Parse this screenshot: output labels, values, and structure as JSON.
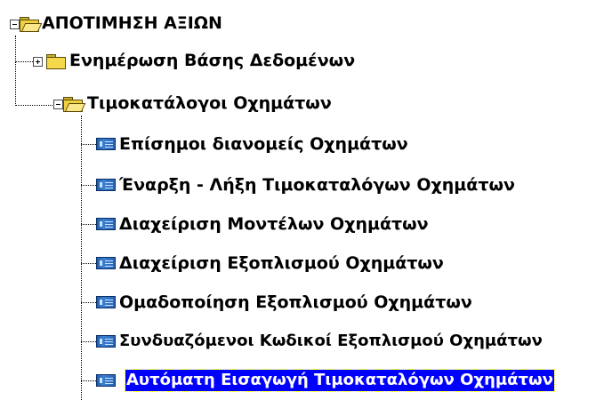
{
  "tree": {
    "root": {
      "label": "ΑΠΟΤΙΜΗΣΗ ΑΞΙΩΝ",
      "expanded": true
    },
    "children": [
      {
        "label": "Ενημέρωση Βάσης Δεδομένων",
        "expanded": false
      },
      {
        "label": "Τιμοκατάλογοι Οχημάτων",
        "expanded": true,
        "items": [
          {
            "label": "Επίσημοι διανομείς Οχημάτων",
            "selected": false
          },
          {
            "label": "Έναρξη - Λήξη Τιμοκαταλόγων Οχημάτων",
            "selected": false
          },
          {
            "label": "Διαχείριση Μοντέλων Οχημάτων",
            "selected": false
          },
          {
            "label": "Διαχείριση Εξοπλισμού Οχημάτων",
            "selected": false
          },
          {
            "label": "Ομαδοποίηση Εξοπλισμού Οχημάτων",
            "selected": false
          },
          {
            "label": "Συνδυαζόμενοι Κωδικοί Εξοπλισμού Οχημάτων",
            "selected": false
          },
          {
            "label": "Αυτόματη Εισαγωγή Τιμοκαταλόγων Οχημάτων",
            "selected": true
          }
        ]
      }
    ],
    "icons": {
      "expanded_toggle": "minus-box-icon",
      "collapsed_toggle": "plus-box-icon",
      "open_folder": "open-folder-icon",
      "closed_folder": "folder-icon",
      "leaf": "form-window-icon"
    },
    "colors": {
      "selection_bg": "#0000ff",
      "selection_text": "#ffffff",
      "folder": "#f4d84a",
      "leaf_icon": "#2866b4"
    }
  }
}
